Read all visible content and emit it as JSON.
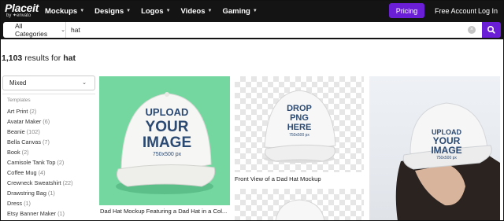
{
  "brand": {
    "name": "Placeit",
    "sub": "by ✦envato",
    "accent": "#6a1fd6"
  },
  "nav": {
    "items": [
      "Mockups",
      "Designs",
      "Logos",
      "Videos",
      "Gaming"
    ],
    "pricing": "Pricing",
    "free_account": "Free Account",
    "login": "Log In"
  },
  "search": {
    "category": "All Categories",
    "query": "hat",
    "icon": "search-icon"
  },
  "results": {
    "count": "1,103",
    "mid": " results for ",
    "term": "hat"
  },
  "sidebar": {
    "sort": "Mixed",
    "section": "Templates",
    "facets": [
      {
        "label": "Art Print",
        "count": "(2)"
      },
      {
        "label": "Avatar Maker",
        "count": "(6)"
      },
      {
        "label": "Beanie",
        "count": "(102)"
      },
      {
        "label": "Bella Canvas",
        "count": "(7)"
      },
      {
        "label": "Book",
        "count": "(2)"
      },
      {
        "label": "Camisole Tank Top",
        "count": "(2)"
      },
      {
        "label": "Coffee Mug",
        "count": "(4)"
      },
      {
        "label": "Crewneck Sweatshirt",
        "count": "(22)"
      },
      {
        "label": "Drawstring Bag",
        "count": "(1)"
      },
      {
        "label": "Dress",
        "count": "(1)"
      },
      {
        "label": "Etsy Banner Maker",
        "count": "(1)"
      }
    ]
  },
  "cards": [
    {
      "caption": "Dad Hat Mockup Featuring a Dad Hat in a Col...",
      "lines": [
        "UPLOAD",
        "YOUR",
        "IMAGE",
        "750x500 px"
      ],
      "bg": "#74d7a0"
    },
    {
      "caption": "Front View of a Dad Hat Mockup",
      "lines": [
        "DROP",
        "PNG",
        "HERE",
        "750x500 px"
      ]
    },
    {
      "lines": []
    },
    {
      "lines": [
        "UPLOAD",
        "YOUR",
        "IMAGE",
        "750x500 px"
      ]
    }
  ]
}
